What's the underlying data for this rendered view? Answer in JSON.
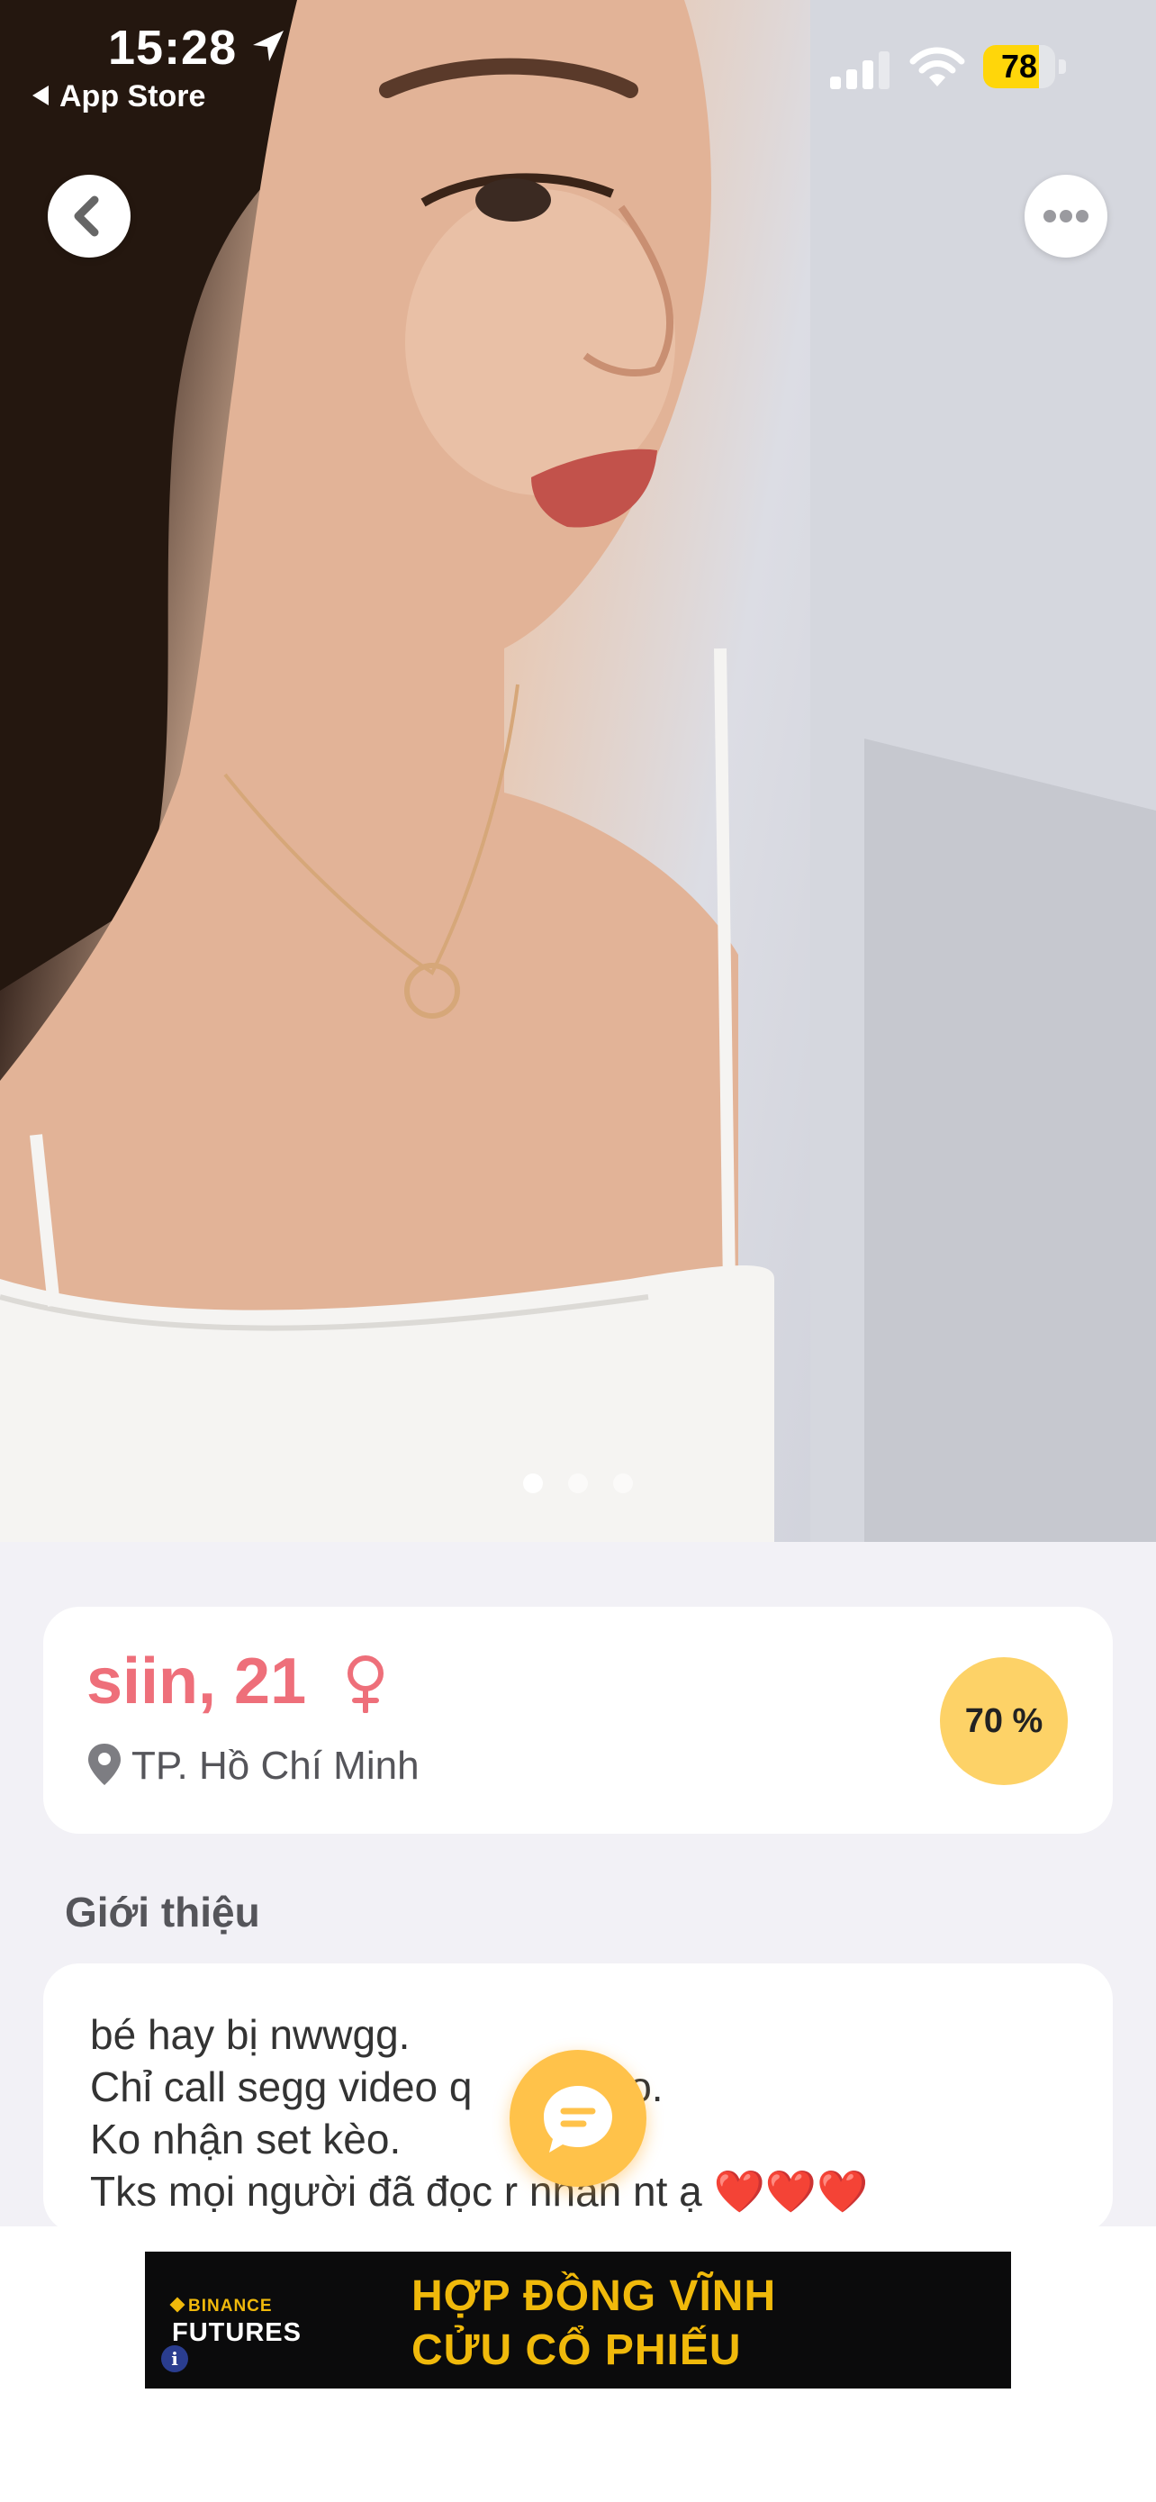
{
  "status_bar": {
    "time": "15:28",
    "back_app": "App Store",
    "battery": 78
  },
  "photo_pager": {
    "count": 3,
    "active": 1
  },
  "profile": {
    "name_age": "siin, 21",
    "gender_icon": "female-icon",
    "location": "TP. Hồ Chí Minh",
    "match_percent": "70 %",
    "intro_title": "Giới thiệu",
    "bio_lines": [
      "bé hay bị nwwgg.",
      "Chỉ call segg video q",
      "lo.",
      "Ko nhận set kèo.",
      "Tks mọi người đã đọc r nhấn nt ạ ❤️❤️❤️"
    ]
  },
  "ad": {
    "brand_line1": "BINANCE",
    "brand_line2": "FUTURES",
    "headline_line1": "HỢP ĐỒNG VĨNH",
    "headline_line2": "CỬU CỔ PHIẾU"
  },
  "colors": {
    "accent_name": "#ee6f7a",
    "match_badge": "#fdd267",
    "chat_button": "#ffc24a",
    "ad_yellow": "#f0b90b"
  },
  "icons": [
    "location-arrow-icon",
    "cellular-signal-icon",
    "wifi-icon",
    "battery-icon",
    "chevron-left-icon",
    "more-dots-icon",
    "female-icon",
    "map-pin-icon",
    "chat-bubble-icon",
    "info-icon"
  ]
}
